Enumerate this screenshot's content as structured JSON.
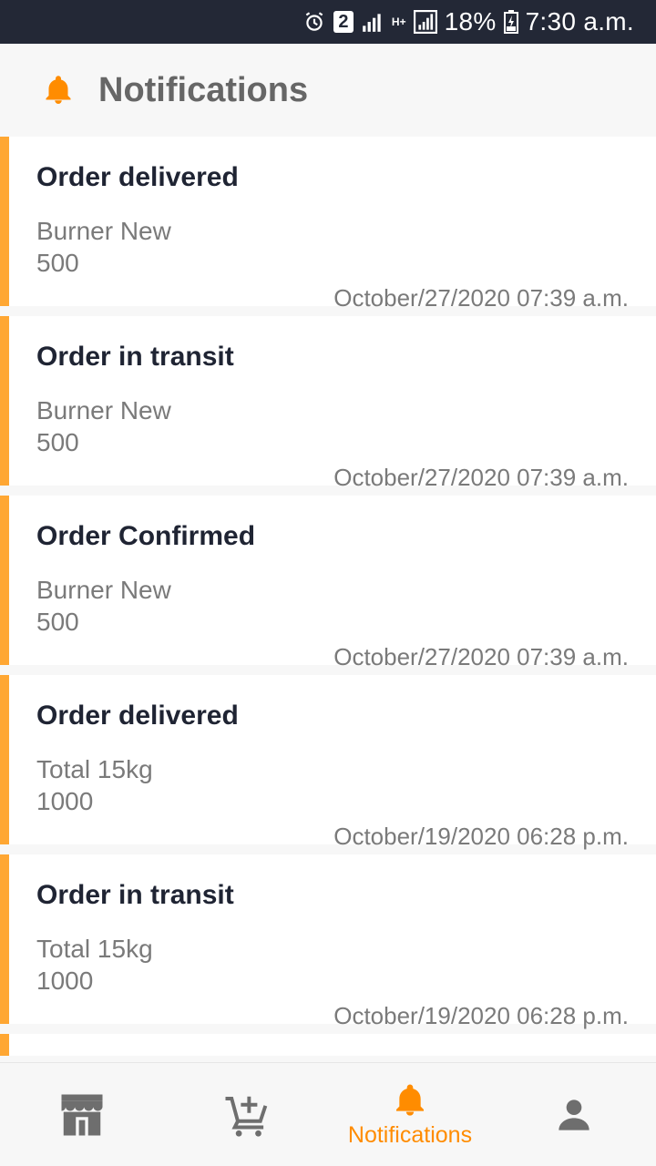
{
  "status_bar": {
    "signal_badge": "2",
    "network_type": "H+",
    "battery": "18%",
    "time": "7:30 a.m."
  },
  "header": {
    "title": "Notifications",
    "accent_color": "#ff8c00"
  },
  "notifications": [
    {
      "title": "Order delivered",
      "product": "Burner New",
      "quantity": "500",
      "date": "October/27/2020 07:39 a.m."
    },
    {
      "title": "Order in transit",
      "product": "Burner New",
      "quantity": "500",
      "date": "October/27/2020 07:39 a.m."
    },
    {
      "title": "Order Confirmed",
      "product": "Burner New",
      "quantity": "500",
      "date": "October/27/2020 07:39 a.m."
    },
    {
      "title": "Order delivered",
      "product": "Total  15kg",
      "quantity": "1000",
      "date": "October/19/2020 06:28 p.m."
    },
    {
      "title": "Order in transit",
      "product": "Total  15kg",
      "quantity": "1000",
      "date": "October/19/2020 06:28 p.m."
    }
  ],
  "bottom_nav": {
    "items": [
      {
        "icon": "store-icon",
        "label": ""
      },
      {
        "icon": "add-cart-icon",
        "label": ""
      },
      {
        "icon": "bell-icon",
        "label": "Notifications"
      },
      {
        "icon": "person-icon",
        "label": ""
      }
    ],
    "active_index": 2
  },
  "colors": {
    "status_bar_bg": "#232836",
    "card_accent": "#ffa733",
    "active": "#ff8c00",
    "inactive_icon": "#6e6e6e"
  }
}
